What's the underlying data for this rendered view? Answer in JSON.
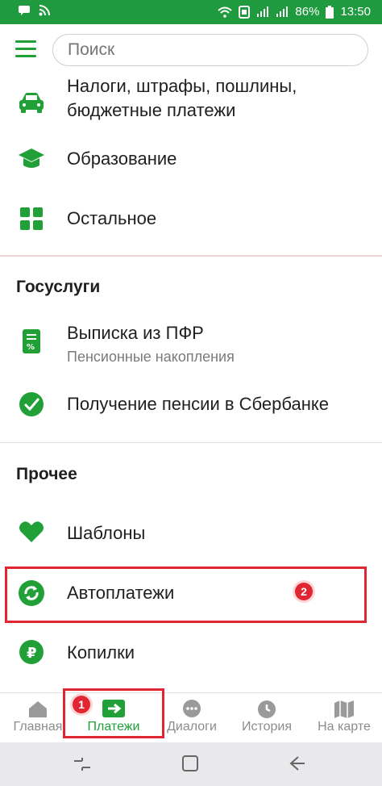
{
  "status_bar": {
    "battery": "86%",
    "time": "13:50"
  },
  "search": {
    "placeholder": "Поиск"
  },
  "items": [
    {
      "label_line1": "Налоги, штрафы, пошлины,",
      "label_line2": "бюджетные платежи",
      "icon": "car-icon"
    },
    {
      "label": "Образование",
      "icon": "graduation-cap-icon"
    },
    {
      "label": "Остальное",
      "icon": "grid-icon"
    }
  ],
  "sections": [
    {
      "title": "Госуслуги",
      "items": [
        {
          "label": "Выписка из ПФР",
          "sub": "Пенсионные накопления",
          "icon": "document-percent-icon"
        },
        {
          "label": "Получение пенсии в Сбербанке",
          "icon": "pension-icon"
        }
      ]
    },
    {
      "title": "Прочее",
      "items": [
        {
          "label": "Шаблоны",
          "icon": "heart-icon"
        },
        {
          "label": "Автоплатежи",
          "icon": "autopay-icon"
        },
        {
          "label": "Копилки",
          "icon": "piggy-bank-icon"
        }
      ]
    }
  ],
  "annotations": {
    "badge1": "1",
    "badge2": "2",
    "color": "#e02633"
  },
  "tabs": [
    {
      "label": "Главная",
      "icon": "home-icon",
      "active": false
    },
    {
      "label": "Платежи",
      "icon": "payments-icon",
      "active": true
    },
    {
      "label": "Диалоги",
      "icon": "chat-icon",
      "active": false
    },
    {
      "label": "История",
      "icon": "clock-icon",
      "active": false
    },
    {
      "label": "На карте",
      "icon": "map-icon",
      "active": false
    }
  ],
  "colors": {
    "brand": "#21a038",
    "status_bar": "#1f9a3f"
  }
}
